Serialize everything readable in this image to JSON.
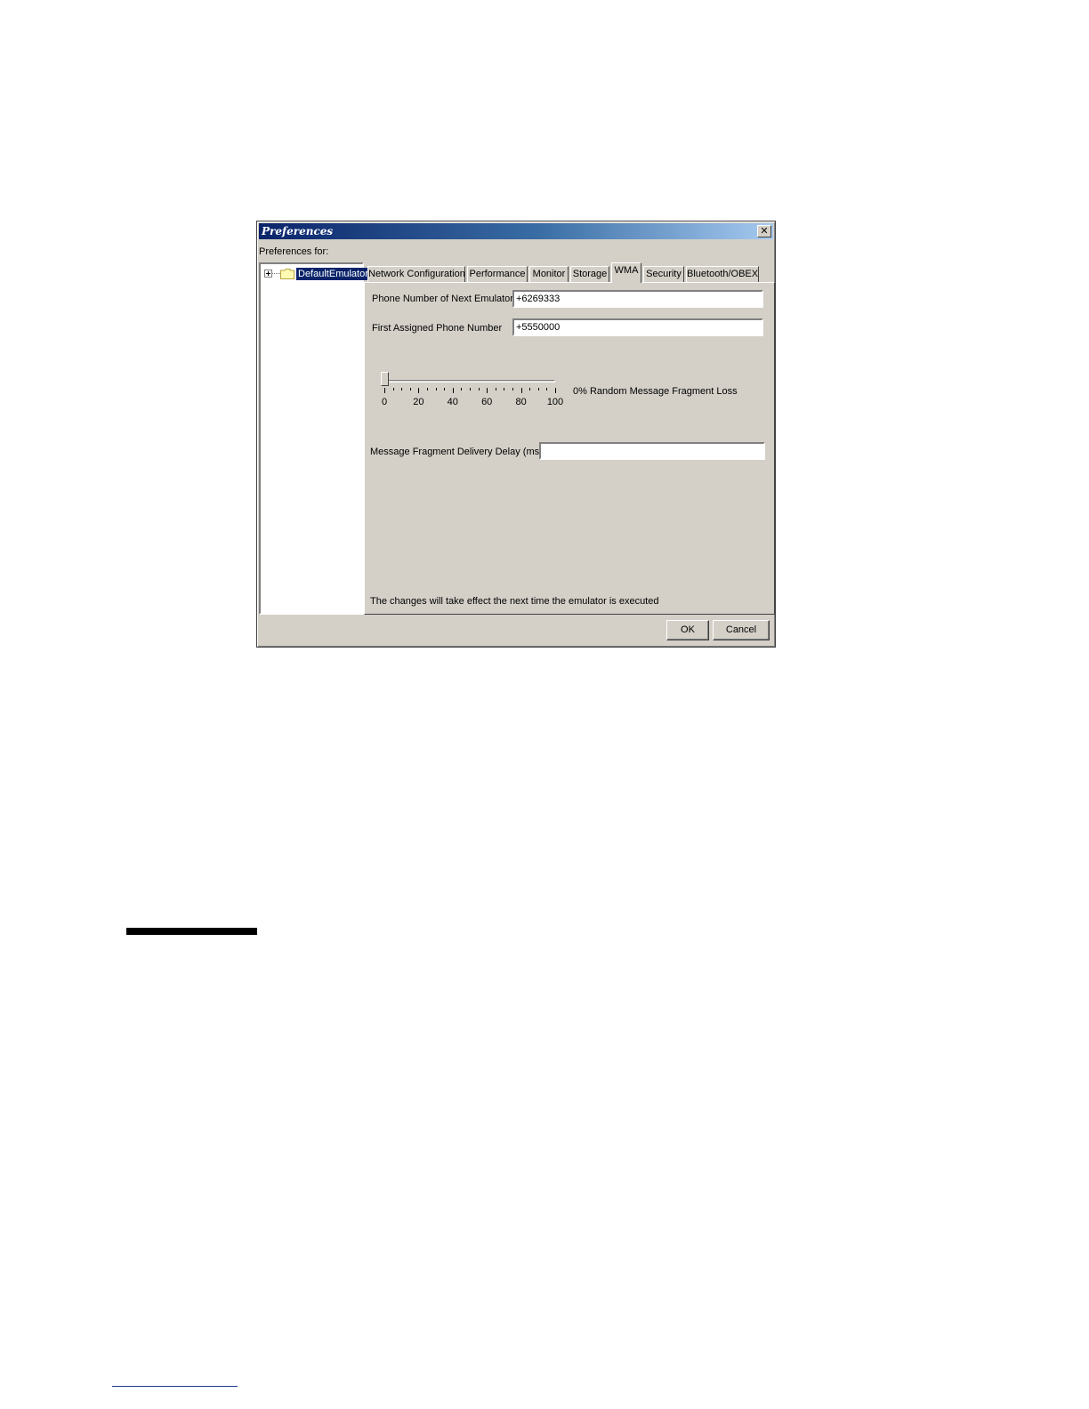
{
  "dialog": {
    "title": "Preferences",
    "close_glyph": "✕",
    "prefs_for_label": "Preferences for:",
    "tree": {
      "item_label": "DefaultEmulator",
      "expander_icon": "plus-expander-icon",
      "node_icon": "folder-icon"
    },
    "tabs": [
      {
        "label": "Network Configuration",
        "active": false
      },
      {
        "label": "Performance",
        "active": false
      },
      {
        "label": "Monitor",
        "active": false
      },
      {
        "label": "Storage",
        "active": false
      },
      {
        "label": "WMA",
        "active": true
      },
      {
        "label": "Security",
        "active": false
      },
      {
        "label": "Bluetooth/OBEX",
        "active": false
      }
    ],
    "wma": {
      "next_phone_label": "Phone Number of Next Emulator :",
      "next_phone_value": "+6269333",
      "first_phone_label": "First Assigned Phone Number    :",
      "first_phone_value": "+5550000",
      "slider": {
        "value_percent": 0,
        "min": 0,
        "max": 100,
        "tick_labels": [
          "0",
          "20",
          "40",
          "60",
          "80",
          "100"
        ],
        "caption": "0% Random Message Fragment Loss"
      },
      "delay_label": "Message Fragment Delivery Delay (ms):",
      "delay_value": "",
      "note": "The changes will take effect the next time the emulator is executed"
    },
    "buttons": {
      "ok": "OK",
      "cancel": "Cancel"
    }
  }
}
